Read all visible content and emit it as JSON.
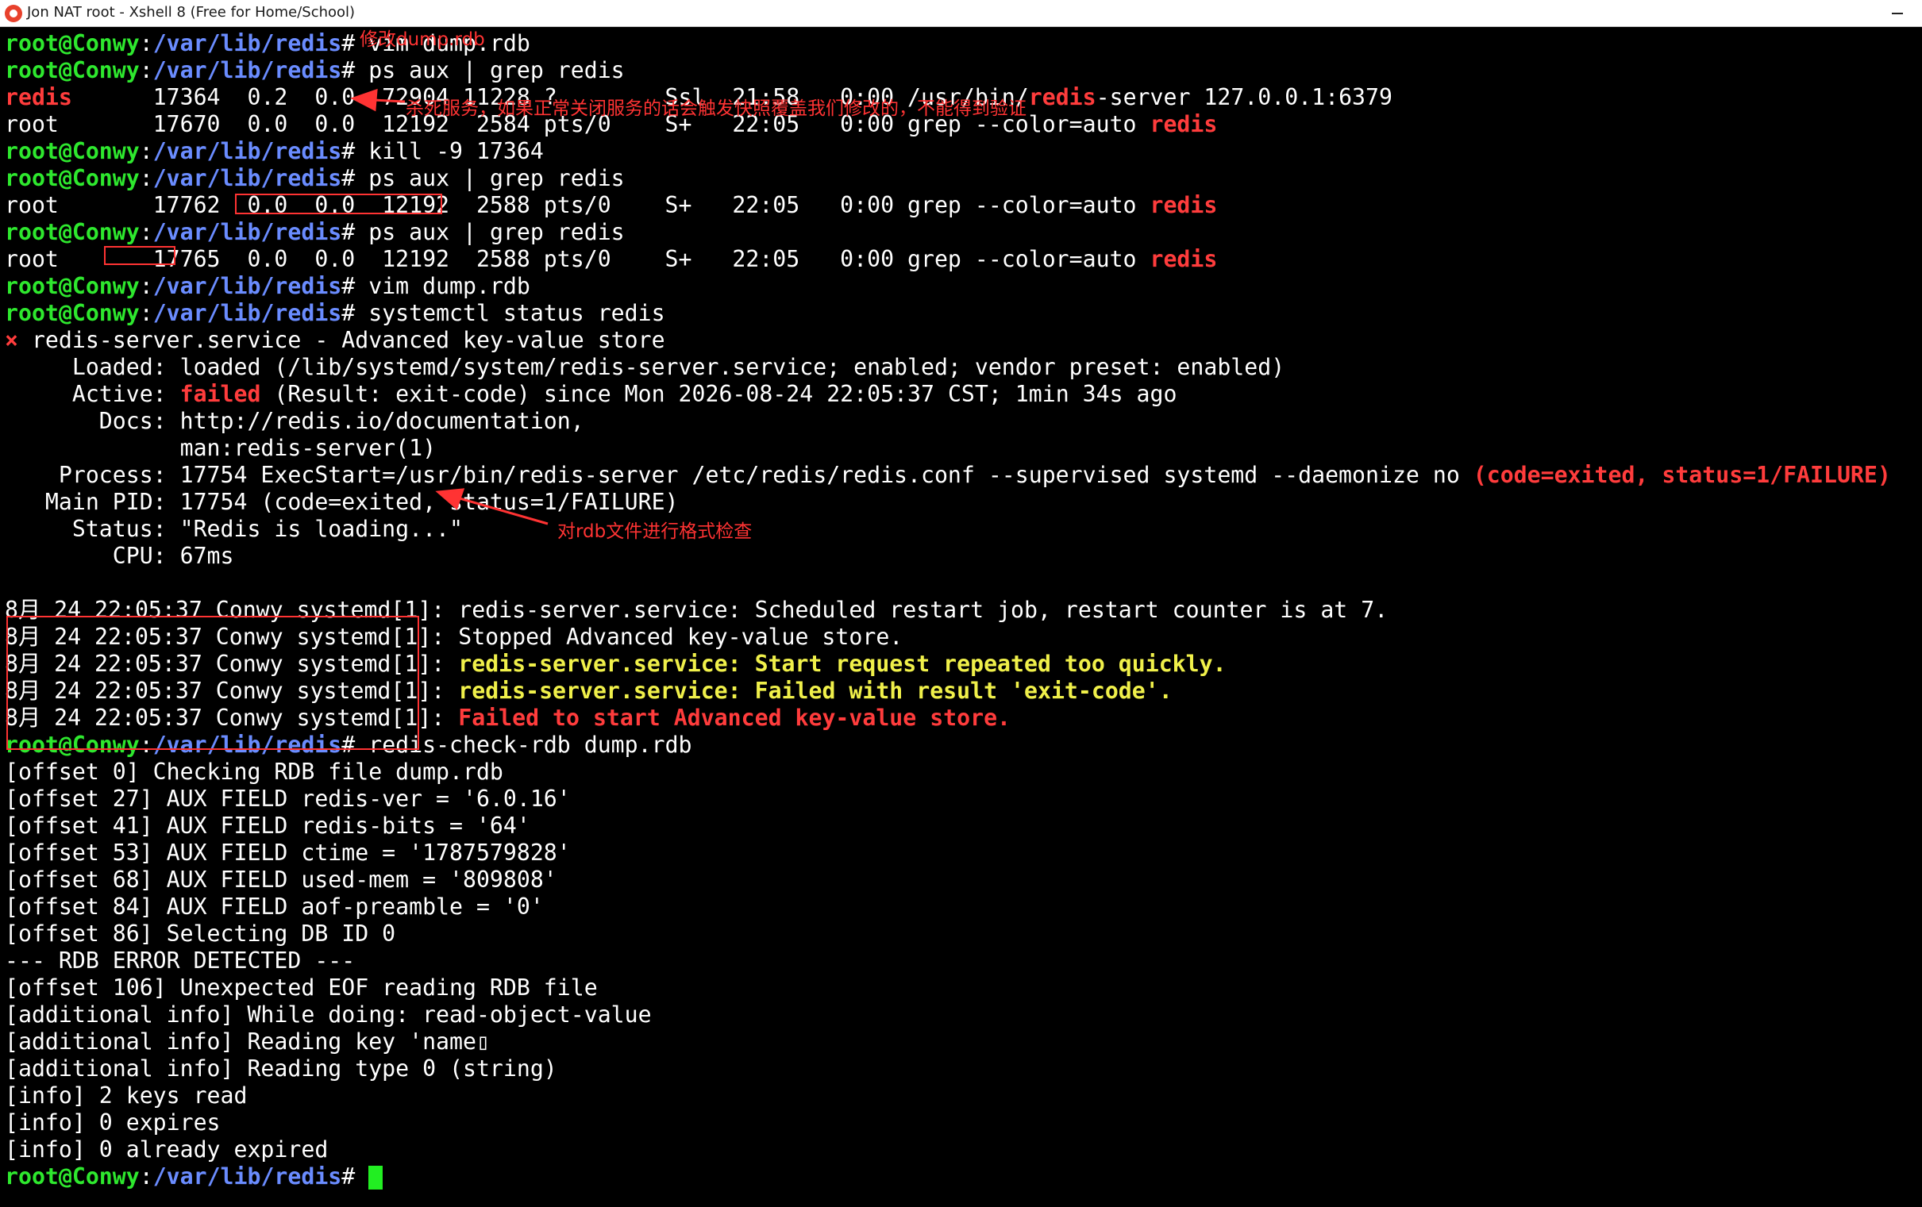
{
  "window": {
    "title": "Jon NAT root - Xshell 8 (Free for Home/School)",
    "icon": "xshell-logo-icon",
    "background_color": "#000000",
    "accent_color": "#ff3333"
  },
  "terminal": {
    "lines": [
      [
        {
          "t": "root@Conwy",
          "c": "g"
        },
        {
          "t": ":"
        },
        {
          "t": "/var/lib/redis",
          "c": "b"
        },
        {
          "t": "# vim dump.rdb"
        }
      ],
      [
        {
          "t": "root@Conwy",
          "c": "g"
        },
        {
          "t": ":"
        },
        {
          "t": "/var/lib/redis",
          "c": "b"
        },
        {
          "t": "# ps aux | grep redis"
        }
      ],
      [
        {
          "t": "redis",
          "c": "r"
        },
        {
          "t": "      17364  0.2  0.0  72904 11228 ?        Ssl  21:58   0:00 /usr/bin/"
        },
        {
          "t": "redis",
          "c": "r"
        },
        {
          "t": "-server 127.0.0.1:6379"
        }
      ],
      [
        {
          "t": "root       17670  0.0  0.0  12192  2584 pts/0    S+   22:05   0:00 grep --color=auto "
        },
        {
          "t": "redis",
          "c": "r"
        }
      ],
      [
        {
          "t": "root@Conwy",
          "c": "g"
        },
        {
          "t": ":"
        },
        {
          "t": "/var/lib/redis",
          "c": "b"
        },
        {
          "t": "# kill -9 17364"
        }
      ],
      [
        {
          "t": "root@Conwy",
          "c": "g"
        },
        {
          "t": ":"
        },
        {
          "t": "/var/lib/redis",
          "c": "b"
        },
        {
          "t": "# ps aux | grep redis"
        }
      ],
      [
        {
          "t": "root       17762  0.0  0.0  12192  2588 pts/0    S+   22:05   0:00 grep --color=auto "
        },
        {
          "t": "redis",
          "c": "r"
        }
      ],
      [
        {
          "t": "root@Conwy",
          "c": "g"
        },
        {
          "t": ":"
        },
        {
          "t": "/var/lib/redis",
          "c": "b"
        },
        {
          "t": "# ps aux | grep redis"
        }
      ],
      [
        {
          "t": "root       17765  0.0  0.0  12192  2588 pts/0    S+   22:05   0:00 grep --color=auto "
        },
        {
          "t": "redis",
          "c": "r"
        }
      ],
      [
        {
          "t": "root@Conwy",
          "c": "g"
        },
        {
          "t": ":"
        },
        {
          "t": "/var/lib/redis",
          "c": "b"
        },
        {
          "t": "# vim dump.rdb"
        }
      ],
      [
        {
          "t": "root@Conwy",
          "c": "g"
        },
        {
          "t": ":"
        },
        {
          "t": "/var/lib/redis",
          "c": "b"
        },
        {
          "t": "# systemctl status redis"
        }
      ],
      [
        {
          "t": "×",
          "c": "r"
        },
        {
          "t": " redis-server.service - Advanced key-value store"
        }
      ],
      [
        {
          "t": "     Loaded: loaded (/lib/systemd/system/redis-server.service; enabled; vendor preset: enabled)"
        }
      ],
      [
        {
          "t": "     Active: "
        },
        {
          "t": "failed",
          "c": "r"
        },
        {
          "t": " (Result: exit-code) since Mon 2026-08-24 22:05:37 CST; 1min 34s ago"
        }
      ],
      [
        {
          "t": "       Docs: http://redis.io/documentation,"
        }
      ],
      [
        {
          "t": "             man:redis-server(1)"
        }
      ],
      [
        {
          "t": "    Process: 17754 ExecStart=/usr/bin/redis-server /etc/redis/redis.conf --supervised systemd --daemonize no "
        },
        {
          "t": "(code=exited, status=1/FAILURE)",
          "c": "r"
        }
      ],
      [
        {
          "t": "   Main PID: 17754 (code=exited, status=1/FAILURE)"
        }
      ],
      [
        {
          "t": "     Status: \"Redis is loading...\""
        }
      ],
      [
        {
          "t": "        CPU: 67ms"
        }
      ],
      [
        {
          "t": ""
        }
      ],
      [
        {
          "t": "8月 24 22:05:37 Conwy systemd[1]: redis-server.service: Scheduled restart job, restart counter is at 7."
        }
      ],
      [
        {
          "t": "8月 24 22:05:37 Conwy systemd[1]: Stopped Advanced key-value store."
        }
      ],
      [
        {
          "t": "8月 24 22:05:37 Conwy systemd[1]: "
        },
        {
          "t": "redis-server.service: Start request repeated too quickly.",
          "c": "y"
        }
      ],
      [
        {
          "t": "8月 24 22:05:37 Conwy systemd[1]: "
        },
        {
          "t": "redis-server.service: Failed with result 'exit-code'.",
          "c": "y"
        }
      ],
      [
        {
          "t": "8月 24 22:05:37 Conwy systemd[1]: "
        },
        {
          "t": "Failed to start Advanced key-value store.",
          "c": "r"
        }
      ],
      [
        {
          "t": "root@Conwy",
          "c": "g"
        },
        {
          "t": ":"
        },
        {
          "t": "/var/lib/redis",
          "c": "b"
        },
        {
          "t": "# redis-check-rdb dump.rdb"
        }
      ],
      [
        {
          "t": "[offset 0] Checking RDB file dump.rdb"
        }
      ],
      [
        {
          "t": "[offset 27] AUX FIELD redis-ver = '6.0.16'"
        }
      ],
      [
        {
          "t": "[offset 41] AUX FIELD redis-bits = '64'"
        }
      ],
      [
        {
          "t": "[offset 53] AUX FIELD ctime = '1787579828'"
        }
      ],
      [
        {
          "t": "[offset 68] AUX FIELD used-mem = '809808'"
        }
      ],
      [
        {
          "t": "[offset 84] AUX FIELD aof-preamble = '0'"
        }
      ],
      [
        {
          "t": "[offset 86] Selecting DB ID 0"
        }
      ],
      [
        {
          "t": "--- RDB ERROR DETECTED ---"
        }
      ],
      [
        {
          "t": "[offset 106] Unexpected EOF reading RDB file"
        }
      ],
      [
        {
          "t": "[additional info] While doing: read-object-value"
        }
      ],
      [
        {
          "t": "[additional info] Reading key 'name▯"
        }
      ],
      [
        {
          "t": "[additional info] Reading type 0 (string)"
        }
      ],
      [
        {
          "t": "[info] 2 keys read"
        }
      ],
      [
        {
          "t": "[info] 0 expires"
        }
      ],
      [
        {
          "t": "[info] 0 already expired"
        }
      ],
      [
        {
          "t": "root@Conwy",
          "c": "g"
        },
        {
          "t": ":"
        },
        {
          "t": "/var/lib/redis",
          "c": "b"
        },
        {
          "t": "# "
        }
      ]
    ]
  },
  "annotations": {
    "note_modify": "修改dump.rdb",
    "note_kill": "杀死服务，如果正常关闭服务的话会触发快照覆盖我们修改的，不能得到验证",
    "note_check": "对rdb文件进行格式检查"
  }
}
